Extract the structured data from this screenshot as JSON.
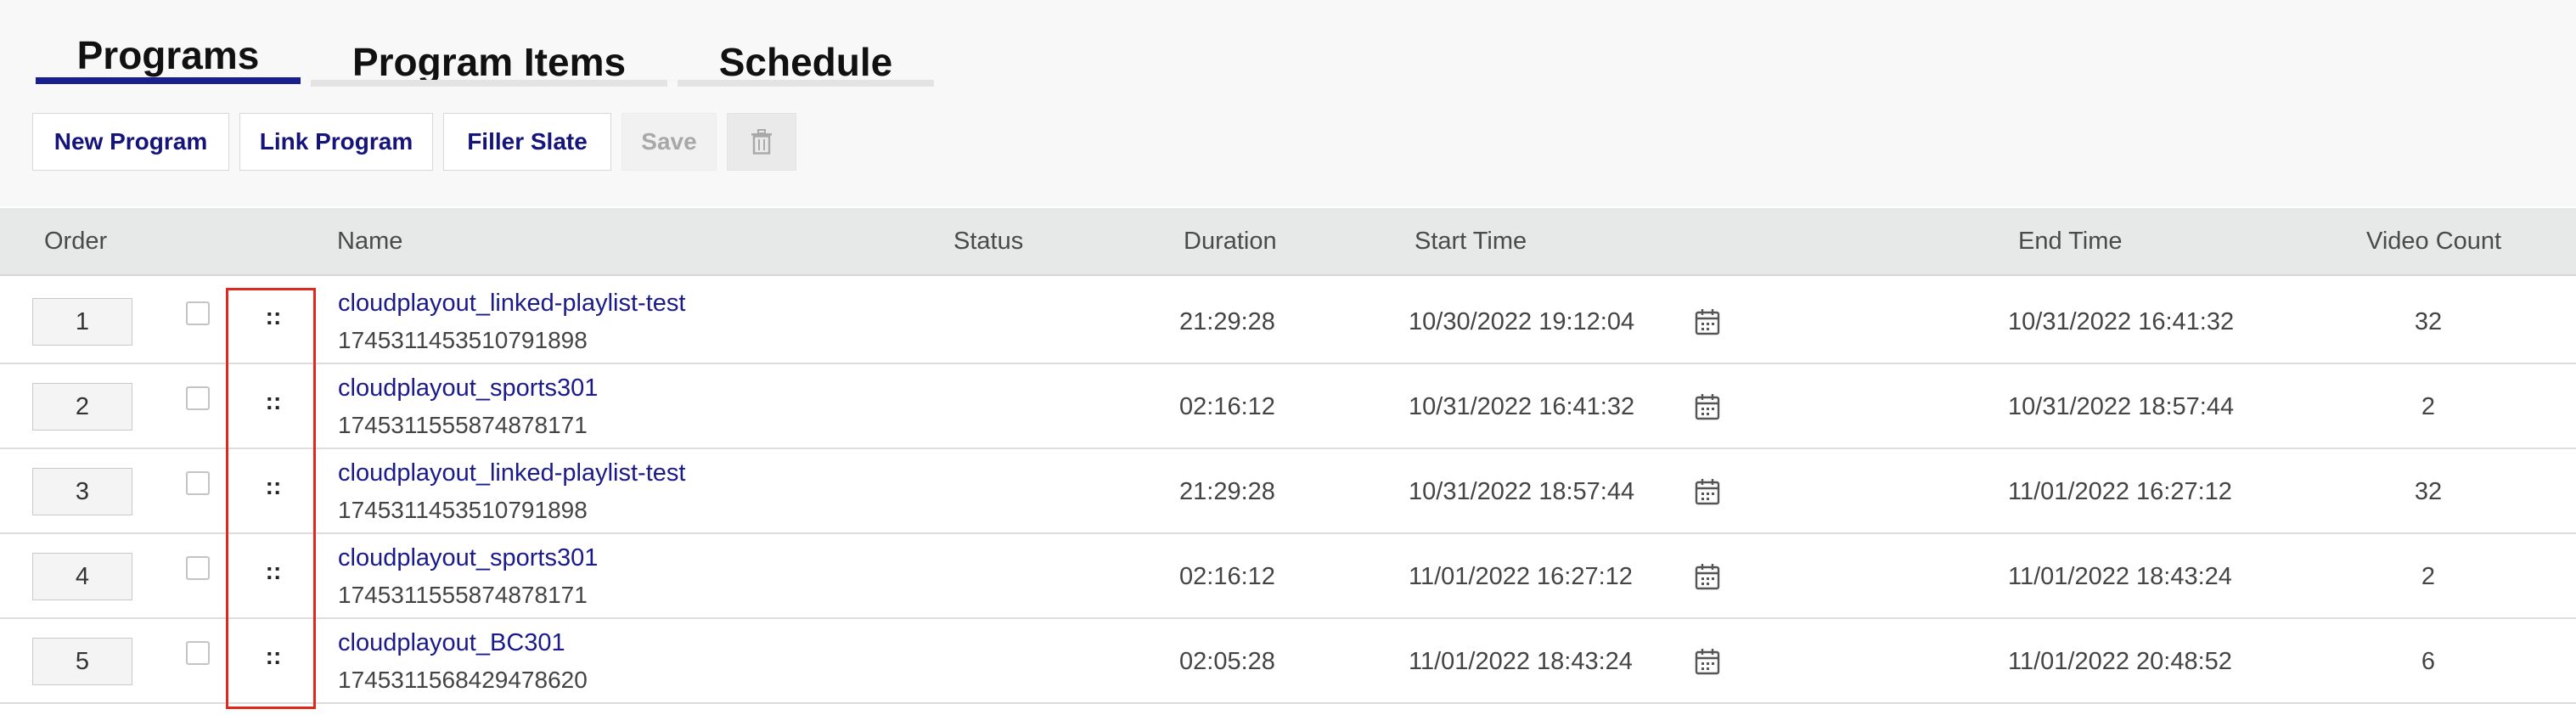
{
  "tabs": [
    {
      "label": "Programs",
      "active": true
    },
    {
      "label": "Program Items",
      "active": false
    },
    {
      "label": "Schedule",
      "active": false
    }
  ],
  "toolbar": {
    "new_program": "New Program",
    "link_program": "Link Program",
    "filler_slate": "Filler Slate",
    "save": "Save",
    "delete_icon": "trash-icon"
  },
  "columns": {
    "order": "Order",
    "name": "Name",
    "status": "Status",
    "duration": "Duration",
    "start_time": "Start Time",
    "end_time": "End Time",
    "video_count": "Video Count"
  },
  "rows": [
    {
      "order": "1",
      "name": "cloudplayout_linked-playlist-test",
      "id": "1745311453510791898",
      "status": "",
      "duration": "21:29:28",
      "start": "10/30/2022 19:12:04",
      "end": "10/31/2022 16:41:32",
      "count": "32"
    },
    {
      "order": "2",
      "name": "cloudplayout_sports301",
      "id": "1745311555874878171",
      "status": "",
      "duration": "02:16:12",
      "start": "10/31/2022 16:41:32",
      "end": "10/31/2022 18:57:44",
      "count": "2"
    },
    {
      "order": "3",
      "name": "cloudplayout_linked-playlist-test",
      "id": "1745311453510791898",
      "status": "",
      "duration": "21:29:28",
      "start": "10/31/2022 18:57:44",
      "end": "11/01/2022 16:27:12",
      "count": "32"
    },
    {
      "order": "4",
      "name": "cloudplayout_sports301",
      "id": "1745311555874878171",
      "status": "",
      "duration": "02:16:12",
      "start": "11/01/2022 16:27:12",
      "end": "11/01/2022 18:43:24",
      "count": "2"
    },
    {
      "order": "5",
      "name": "cloudplayout_BC301",
      "id": "1745311568429478620",
      "status": "",
      "duration": "02:05:28",
      "start": "11/01/2022 18:43:24",
      "end": "11/01/2022 20:48:52",
      "count": "6"
    }
  ],
  "drag_handle_glyph": "::",
  "colors": {
    "active_tab_underline": "#1a1f8f",
    "link_text": "#1a1a8a",
    "highlight_box": "#e0291b",
    "header_bg": "#e7e8e8"
  }
}
